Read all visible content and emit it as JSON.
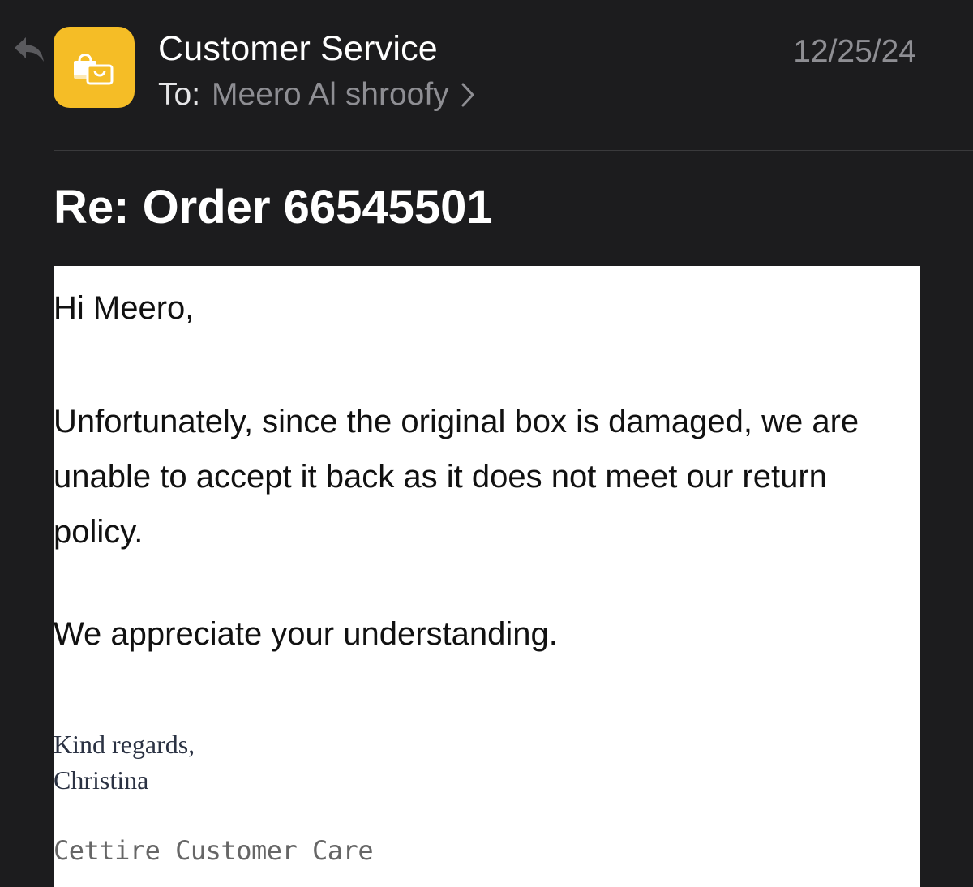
{
  "header": {
    "sender": "Customer Service",
    "to_label": "To:",
    "recipient": "Meero Al shroofy",
    "date": "12/25/24"
  },
  "subject": "Re: Order 66545501",
  "message": {
    "greeting": "Hi Meero,",
    "paragraph": "Unfortunately, since the original box is damaged, we are unable to accept it back as it does not meet our return policy.",
    "appreciation": "We appreciate your understanding.",
    "signoff": "Kind regards,",
    "signer": "Christina",
    "team": "Cettire Customer Care"
  },
  "icons": {
    "reply": "reply-arrow-icon",
    "avatar": "shopping-bag-icon",
    "chevron": "chevron-right-icon"
  },
  "colors": {
    "background": "#1c1c1e",
    "avatar": "#f5bd26",
    "secondary_text": "#8e8e93"
  }
}
